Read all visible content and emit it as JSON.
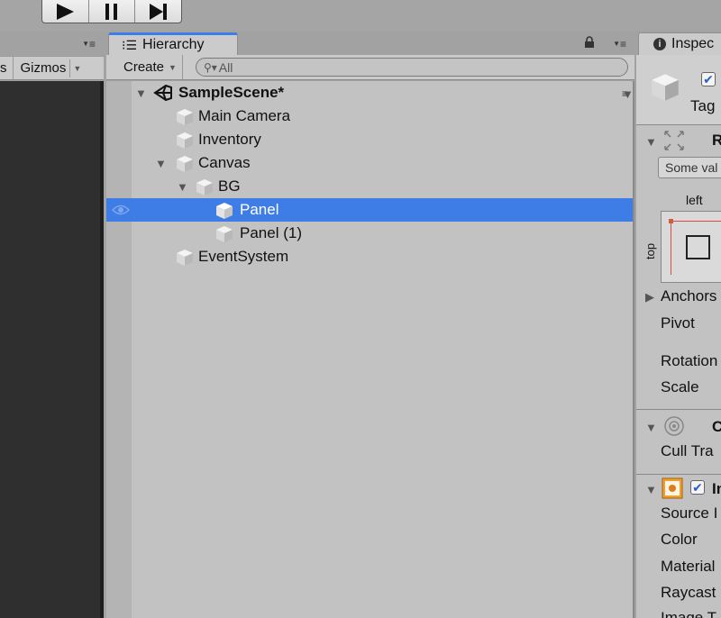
{
  "toolbar": {
    "play_icon": "play-icon",
    "pause_icon": "pause-icon",
    "step_icon": "step-icon"
  },
  "scene": {
    "tab_label_partial": "s",
    "gizmos_label": "Gizmos"
  },
  "hierarchy": {
    "tab_label": "Hierarchy",
    "create_label": "Create",
    "search_placeholder": "All",
    "scene_name": "SampleScene*",
    "items": [
      {
        "label": "Main Camera"
      },
      {
        "label": "Inventory"
      },
      {
        "label": "Canvas"
      },
      {
        "label": "BG"
      },
      {
        "label": "Panel"
      },
      {
        "label": "Panel (1)"
      },
      {
        "label": "EventSystem"
      }
    ]
  },
  "inspector": {
    "tab_label": "Inspec",
    "tag_label": "Tag",
    "rect_section_initial": "R",
    "some_values": "Some val",
    "left_label": "left",
    "top_label": "top",
    "anchors_label": "Anchors",
    "pivot_label": "Pivot",
    "rotation_label": "Rotation",
    "scale_label": "Scale",
    "canvas_renderer_initial": "C",
    "cull_label": "Cull Tra",
    "image_initial": "Im",
    "source_label": "Source I",
    "color_label": "Color",
    "material_label": "Material",
    "raycast_label": "Raycast",
    "image_type_label": "Image T"
  },
  "colors": {
    "selection": "#3e7de6",
    "tab_accent": "#3e7ce6",
    "panel_bg": "#c2c2c2",
    "scene_bg": "#2f2f2f"
  }
}
